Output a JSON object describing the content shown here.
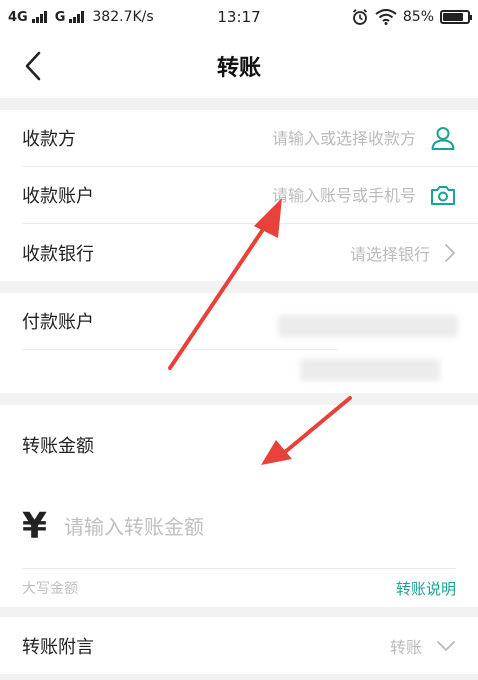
{
  "status_bar": {
    "network_1": "4G",
    "network_2": "G",
    "speed": "382.7K/s",
    "time": "13:17",
    "battery_text": "85%",
    "battery_level": 0.85
  },
  "nav": {
    "title": "转账"
  },
  "payee": {
    "label": "收款方",
    "placeholder": "请输入或选择收款方"
  },
  "account": {
    "label": "收款账户",
    "placeholder": "请输入账号或手机号"
  },
  "bank": {
    "label": "收款银行",
    "placeholder": "请选择银行"
  },
  "payer": {
    "label": "付款账户"
  },
  "amount": {
    "label": "转账金额",
    "currency_symbol": "¥",
    "placeholder": "请输入转账金额",
    "caps_label": "大写金额",
    "explain_link": "转账说明"
  },
  "remark": {
    "label": "转账附言",
    "value": "转账"
  },
  "colors": {
    "accent": "#1aa394",
    "annotation_arrow": "#e8413a"
  }
}
